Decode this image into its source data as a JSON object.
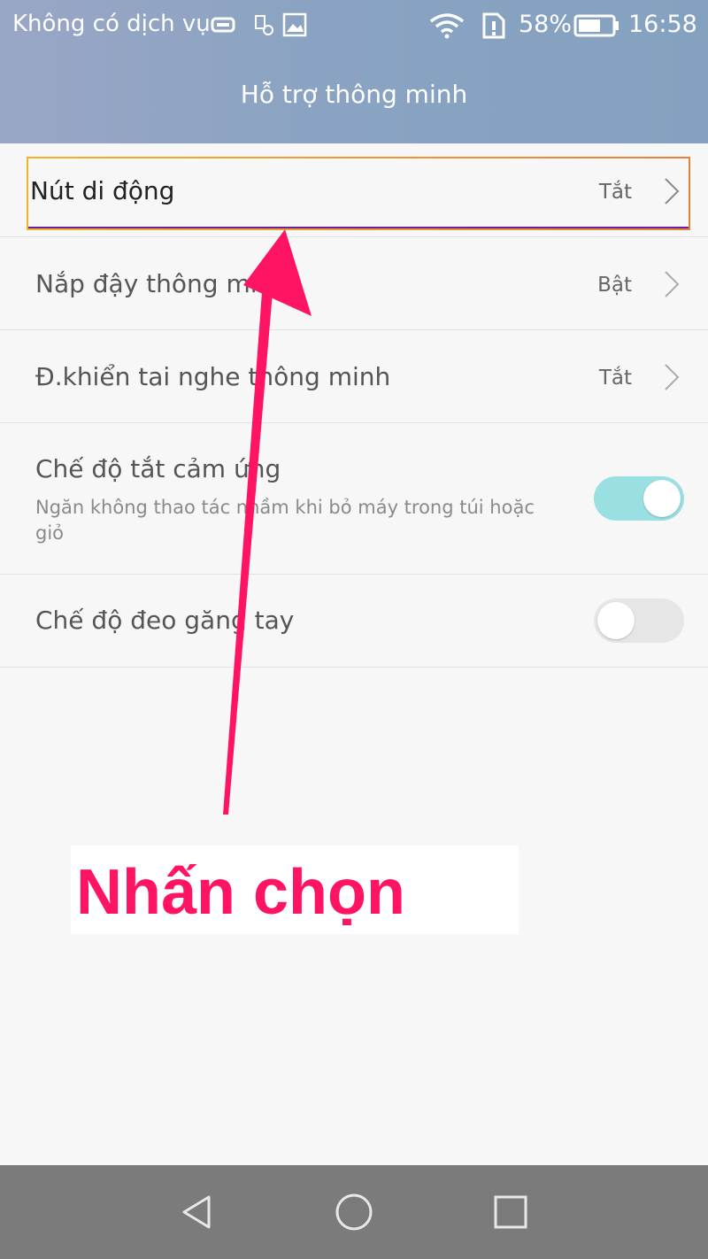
{
  "status_bar": {
    "carrier": "Không có dịch vụ",
    "battery": "58%",
    "time": "16:58",
    "icons": [
      "message-icon",
      "notification-icon",
      "image-icon",
      "wifi-icon",
      "sim-alert-icon",
      "battery-icon"
    ]
  },
  "header": {
    "title": "Hỗ trợ thông minh"
  },
  "settings": [
    {
      "label": "Nút di động",
      "value": "Tắt"
    },
    {
      "label": "Nắp đậy thông minh",
      "value": "Bật"
    },
    {
      "label": "Đ.khiển tai nghe thông minh",
      "value": "Tắt"
    },
    {
      "label": "Chế độ tắt cảm ứng",
      "subtitle": "Ngăn không thao tác nhầm khi bỏ máy trong túi hoặc giỏ",
      "toggle": "on"
    },
    {
      "label": "Chế độ đeo găng tay",
      "toggle": "off"
    }
  ],
  "annotation": {
    "text": "Nhấn chọn",
    "color": "#ff1464"
  },
  "colors": {
    "header": "#8aa3c2",
    "toggle_on": "#9adfe2",
    "nav_bar": "#7b7b7b"
  },
  "nav_bar": {
    "buttons": [
      "back-icon",
      "home-icon",
      "recents-icon"
    ]
  }
}
